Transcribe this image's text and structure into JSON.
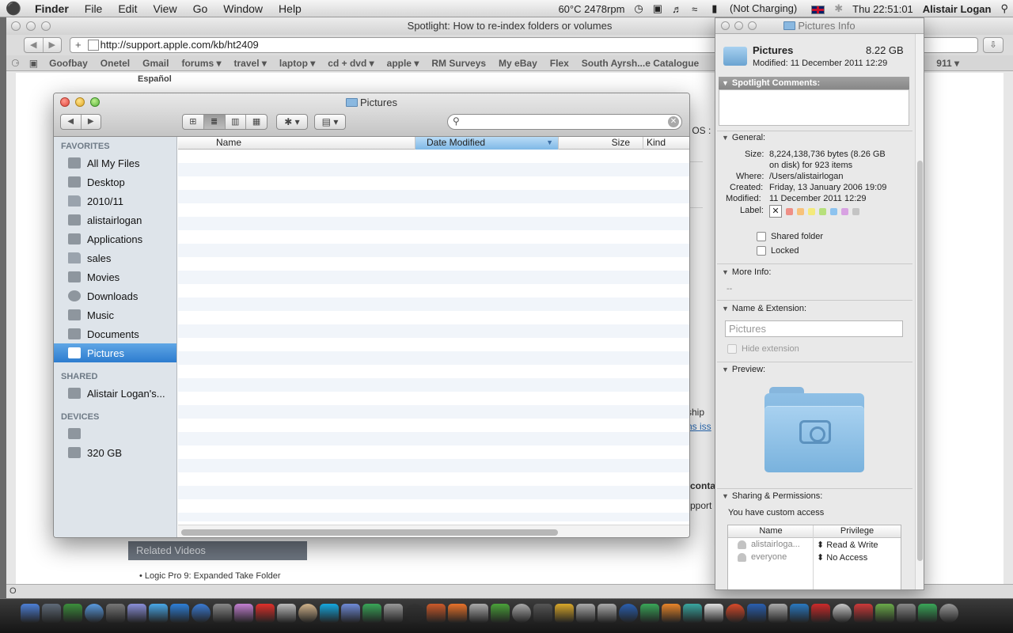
{
  "menubar": {
    "apple": "",
    "app": "Finder",
    "menus": [
      "File",
      "Edit",
      "View",
      "Go",
      "Window",
      "Help"
    ],
    "status": "60°C 2478rpm",
    "battery": "(Not Charging)",
    "clock": "Thu 22:51:01",
    "user": "Alistair Logan"
  },
  "browser": {
    "title": "Spotlight: How to re-index folders or volumes",
    "url": "http://support.apple.com/kb/ht2409",
    "bookmarks": [
      "Goofbay",
      "Onetel",
      "Gmail",
      "forums ▾",
      "travel ▾",
      "laptop ▾",
      "cd + dvd ▾",
      "apple ▾",
      "RM Surveys",
      "My eBay",
      "Flex",
      "South Ayrsh...e Catalogue",
      "911 ▾"
    ],
    "page": {
      "espanol": "Español",
      "related_videos": "Related Videos",
      "related_item": "• Logic Pro 9: Expanded Take Folder",
      "frag_osx": "c OS :",
      "frag_ship": "ship",
      "frag_link": "ns iss",
      "frag_conta": "conta",
      "frag_pport": "pport",
      "status_char": "O"
    }
  },
  "finder": {
    "title": "Pictures",
    "nav": {
      "back": "◀",
      "forward": "▶"
    },
    "views": [
      "⊞",
      "≣",
      "▥",
      "▦"
    ],
    "action_label": "✱ ▾",
    "arrange_label": "▤ ▾",
    "search": {
      "placeholder": "",
      "value": ""
    },
    "sidebar": {
      "favorites_header": "FAVORITES",
      "favorites": [
        "All My Files",
        "Desktop",
        "2010/11",
        "alistairlogan",
        "Applications",
        "sales",
        "Movies",
        "Downloads",
        "Music",
        "Documents",
        "Pictures"
      ],
      "selected": "Pictures",
      "shared_header": "SHARED",
      "shared": [
        "Alistair Logan's..."
      ],
      "devices_header": "DEVICES",
      "devices": [
        "",
        "320 GB"
      ]
    },
    "columns": {
      "name": "Name",
      "date_modified": "Date Modified",
      "sort_indicator": "▼",
      "size": "Size",
      "kind": "Kind"
    }
  },
  "info": {
    "title": "Pictures Info",
    "name": "Pictures",
    "size_short": "8.22 GB",
    "modified_line": "Modified: 11 December 2011 12:29",
    "spotlight_comments": "Spotlight Comments:",
    "general": {
      "header": "General:",
      "size_label": "Size:",
      "size_value_1": "8,224,138,736 bytes (8.26 GB",
      "size_value_2": "on disk) for 923 items",
      "where_label": "Where:",
      "where_value": "/Users/alistairlogan",
      "created_label": "Created:",
      "created_value": "Friday, 13 January 2006 19:09",
      "modified_label": "Modified:",
      "modified_value": "11 December 2011 12:29",
      "label_label": "Label:",
      "label_none": "✕",
      "label_colors": [
        "#ef8f86",
        "#f7c27a",
        "#f4ea7c",
        "#b7e07c",
        "#8dc3ef",
        "#d8a2e2",
        "#c4c4c4"
      ],
      "shared_folder": "Shared folder",
      "locked": "Locked"
    },
    "more_info": {
      "header": "More Info:",
      "value": "--"
    },
    "name_ext": {
      "header": "Name & Extension:",
      "value": "Pictures",
      "hide_extension": "Hide extension"
    },
    "preview": {
      "header": "Preview:"
    },
    "sharing": {
      "header": "Sharing & Permissions:",
      "access": "You have custom access",
      "col_name": "Name",
      "col_privilege": "Privilege",
      "rows": [
        {
          "name": "alistairloga...",
          "privilege": "Read & Write"
        },
        {
          "name": "everyone",
          "privilege": "No Access"
        }
      ],
      "stepper": "⬍"
    },
    "triangle": "▼"
  },
  "dock": {
    "icon_colors": [
      "#4d7fd6",
      "#5f6a78",
      "#3c8f3c",
      "#5a9be0",
      "#777777",
      "#8a8fd8",
      "#49a8e8",
      "#2e7fd8",
      "#3b7bd4",
      "#888888",
      "#c27fd1",
      "#e0302a",
      "#bbbbbb",
      "#d2b48c",
      "#15a8e0",
      "#6f8bd8",
      "#3aa658",
      "#999999",
      "#333333",
      "#cc5a2a",
      "#e8722a",
      "#aaaaaa",
      "#4aa23a",
      "#aaaaaa",
      "#555555",
      "#d9a82a",
      "#aaaaaa",
      "#aaaaaa",
      "#2a5fb0",
      "#3aa658",
      "#e8852a",
      "#3aa6a0",
      "#e0e0e0",
      "#d84a2a",
      "#2a5fb0",
      "#aaaaaa",
      "#2a78c0",
      "#cc2a2a",
      "#c8c8c8",
      "#cc3a3a",
      "#6aaa4a",
      "#888888",
      "#3aa658",
      "#999999"
    ]
  }
}
